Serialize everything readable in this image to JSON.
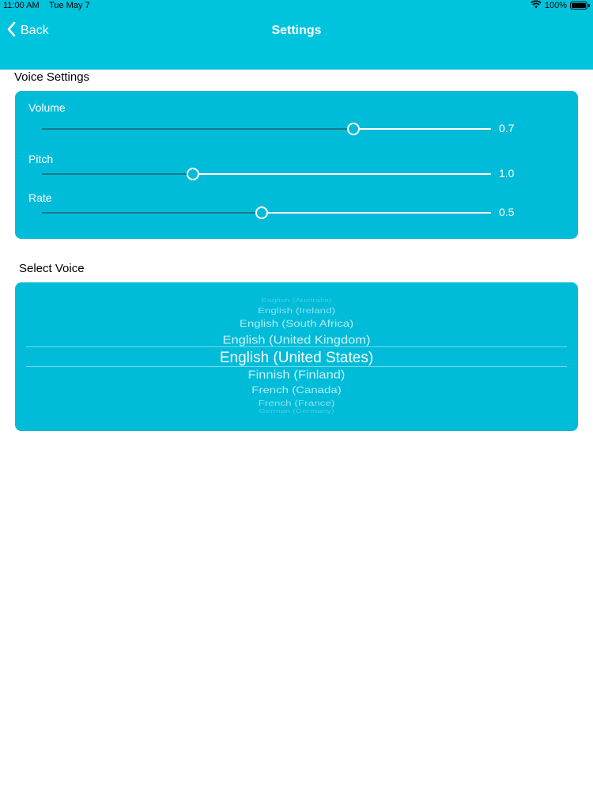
{
  "status_bar": {
    "time": "11:00 AM",
    "date": "Tue May 7",
    "battery": "100%",
    "battery_level": 1.0
  },
  "nav": {
    "back_label": "Back",
    "title": "Settings"
  },
  "voice_settings": {
    "title": "Voice Settings",
    "sliders": [
      {
        "label": "Volume",
        "value_text": "0.7",
        "position": 0.693
      },
      {
        "label": "Pitch",
        "value_text": "1.0",
        "position": 0.337
      },
      {
        "label": "Rate",
        "value_text": "0.5",
        "position": 0.49
      }
    ]
  },
  "select_voice": {
    "title": "Select Voice",
    "options": [
      "English (Australia)",
      "English (Ireland)",
      "English (South Africa)",
      "English (United Kingdom)",
      "English (United States)",
      "Finnish (Finland)",
      "French (Canada)",
      "French (France)",
      "German (Germany)"
    ],
    "selected": "English (United States)"
  },
  "colors": {
    "accent": "#00c4dd",
    "card": "#00bcd9",
    "text_on_accent": "#ffffff"
  }
}
